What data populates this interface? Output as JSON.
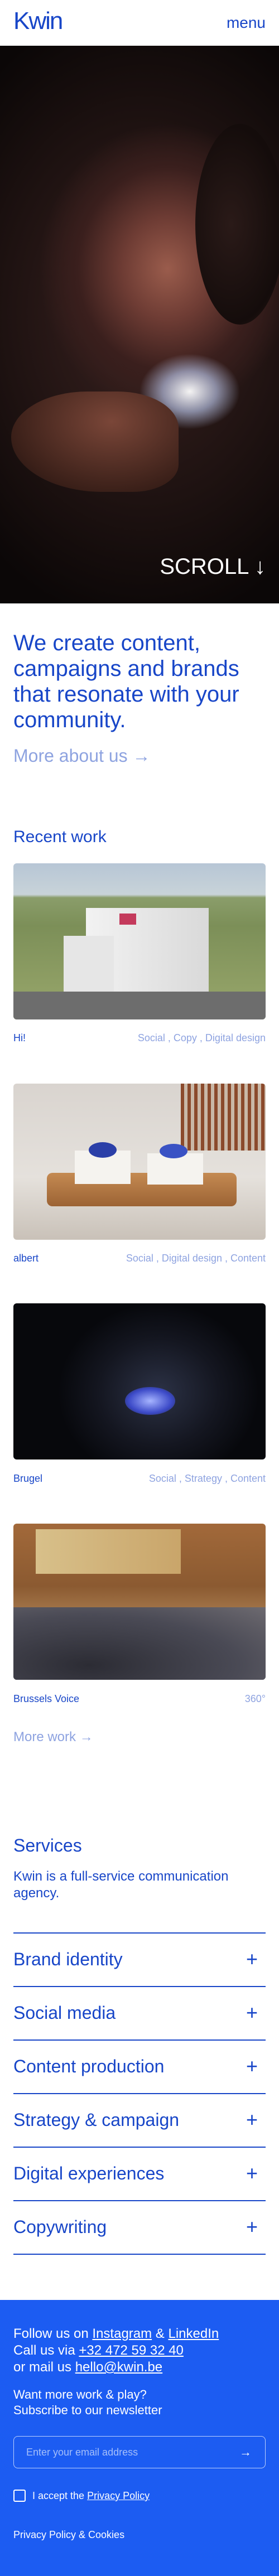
{
  "header": {
    "logo": "Kwin",
    "menu": "menu"
  },
  "hero": {
    "scroll": "SCROLL ↓"
  },
  "intro": {
    "text": "We create content, campaigns and brands that resonate with your community.",
    "link": "More about us →"
  },
  "recent": {
    "title": "Recent work",
    "items": [
      {
        "name": "Hi!",
        "tags": "Social ,  Copy ,  Digital design"
      },
      {
        "name": "albert",
        "tags": "Social ,  Digital design ,  Content"
      },
      {
        "name": "Brugel",
        "tags": "Social ,  Strategy ,  Content"
      },
      {
        "name": "Brussels Voice",
        "tags": "360°"
      }
    ],
    "more": "More work →"
  },
  "services": {
    "title": "Services",
    "description": "Kwin is a full-service communication agency.",
    "items": [
      {
        "label": "Brand identity"
      },
      {
        "label": "Social media"
      },
      {
        "label": "Content production"
      },
      {
        "label": "Strategy & campaign"
      },
      {
        "label": "Digital experiences"
      },
      {
        "label": "Copywriting"
      }
    ],
    "plus": "+"
  },
  "footer": {
    "follow_prefix": "Follow us on",
    "instagram": "Instagram",
    "amp": "&",
    "linkedin": "LinkedIn",
    "call_prefix": "Call us via",
    "phone": "+32 472 59 32 40",
    "mail_prefix": "or mail us",
    "email": "hello@kwin.be",
    "newsletter_line1": "Want more work & play?",
    "newsletter_line2": "Subscribe to our newsletter",
    "email_placeholder": "Enter your email address",
    "submit_arrow": "→",
    "accept_prefix": "I accept the",
    "privacy_link": "Privacy Policy",
    "privacy_cookies": "Privacy Policy & Cookies"
  },
  "colors": {
    "brand_blue": "#1846c8",
    "footer_blue": "#1c5cf2",
    "muted_blue": "#8ea3e0"
  }
}
